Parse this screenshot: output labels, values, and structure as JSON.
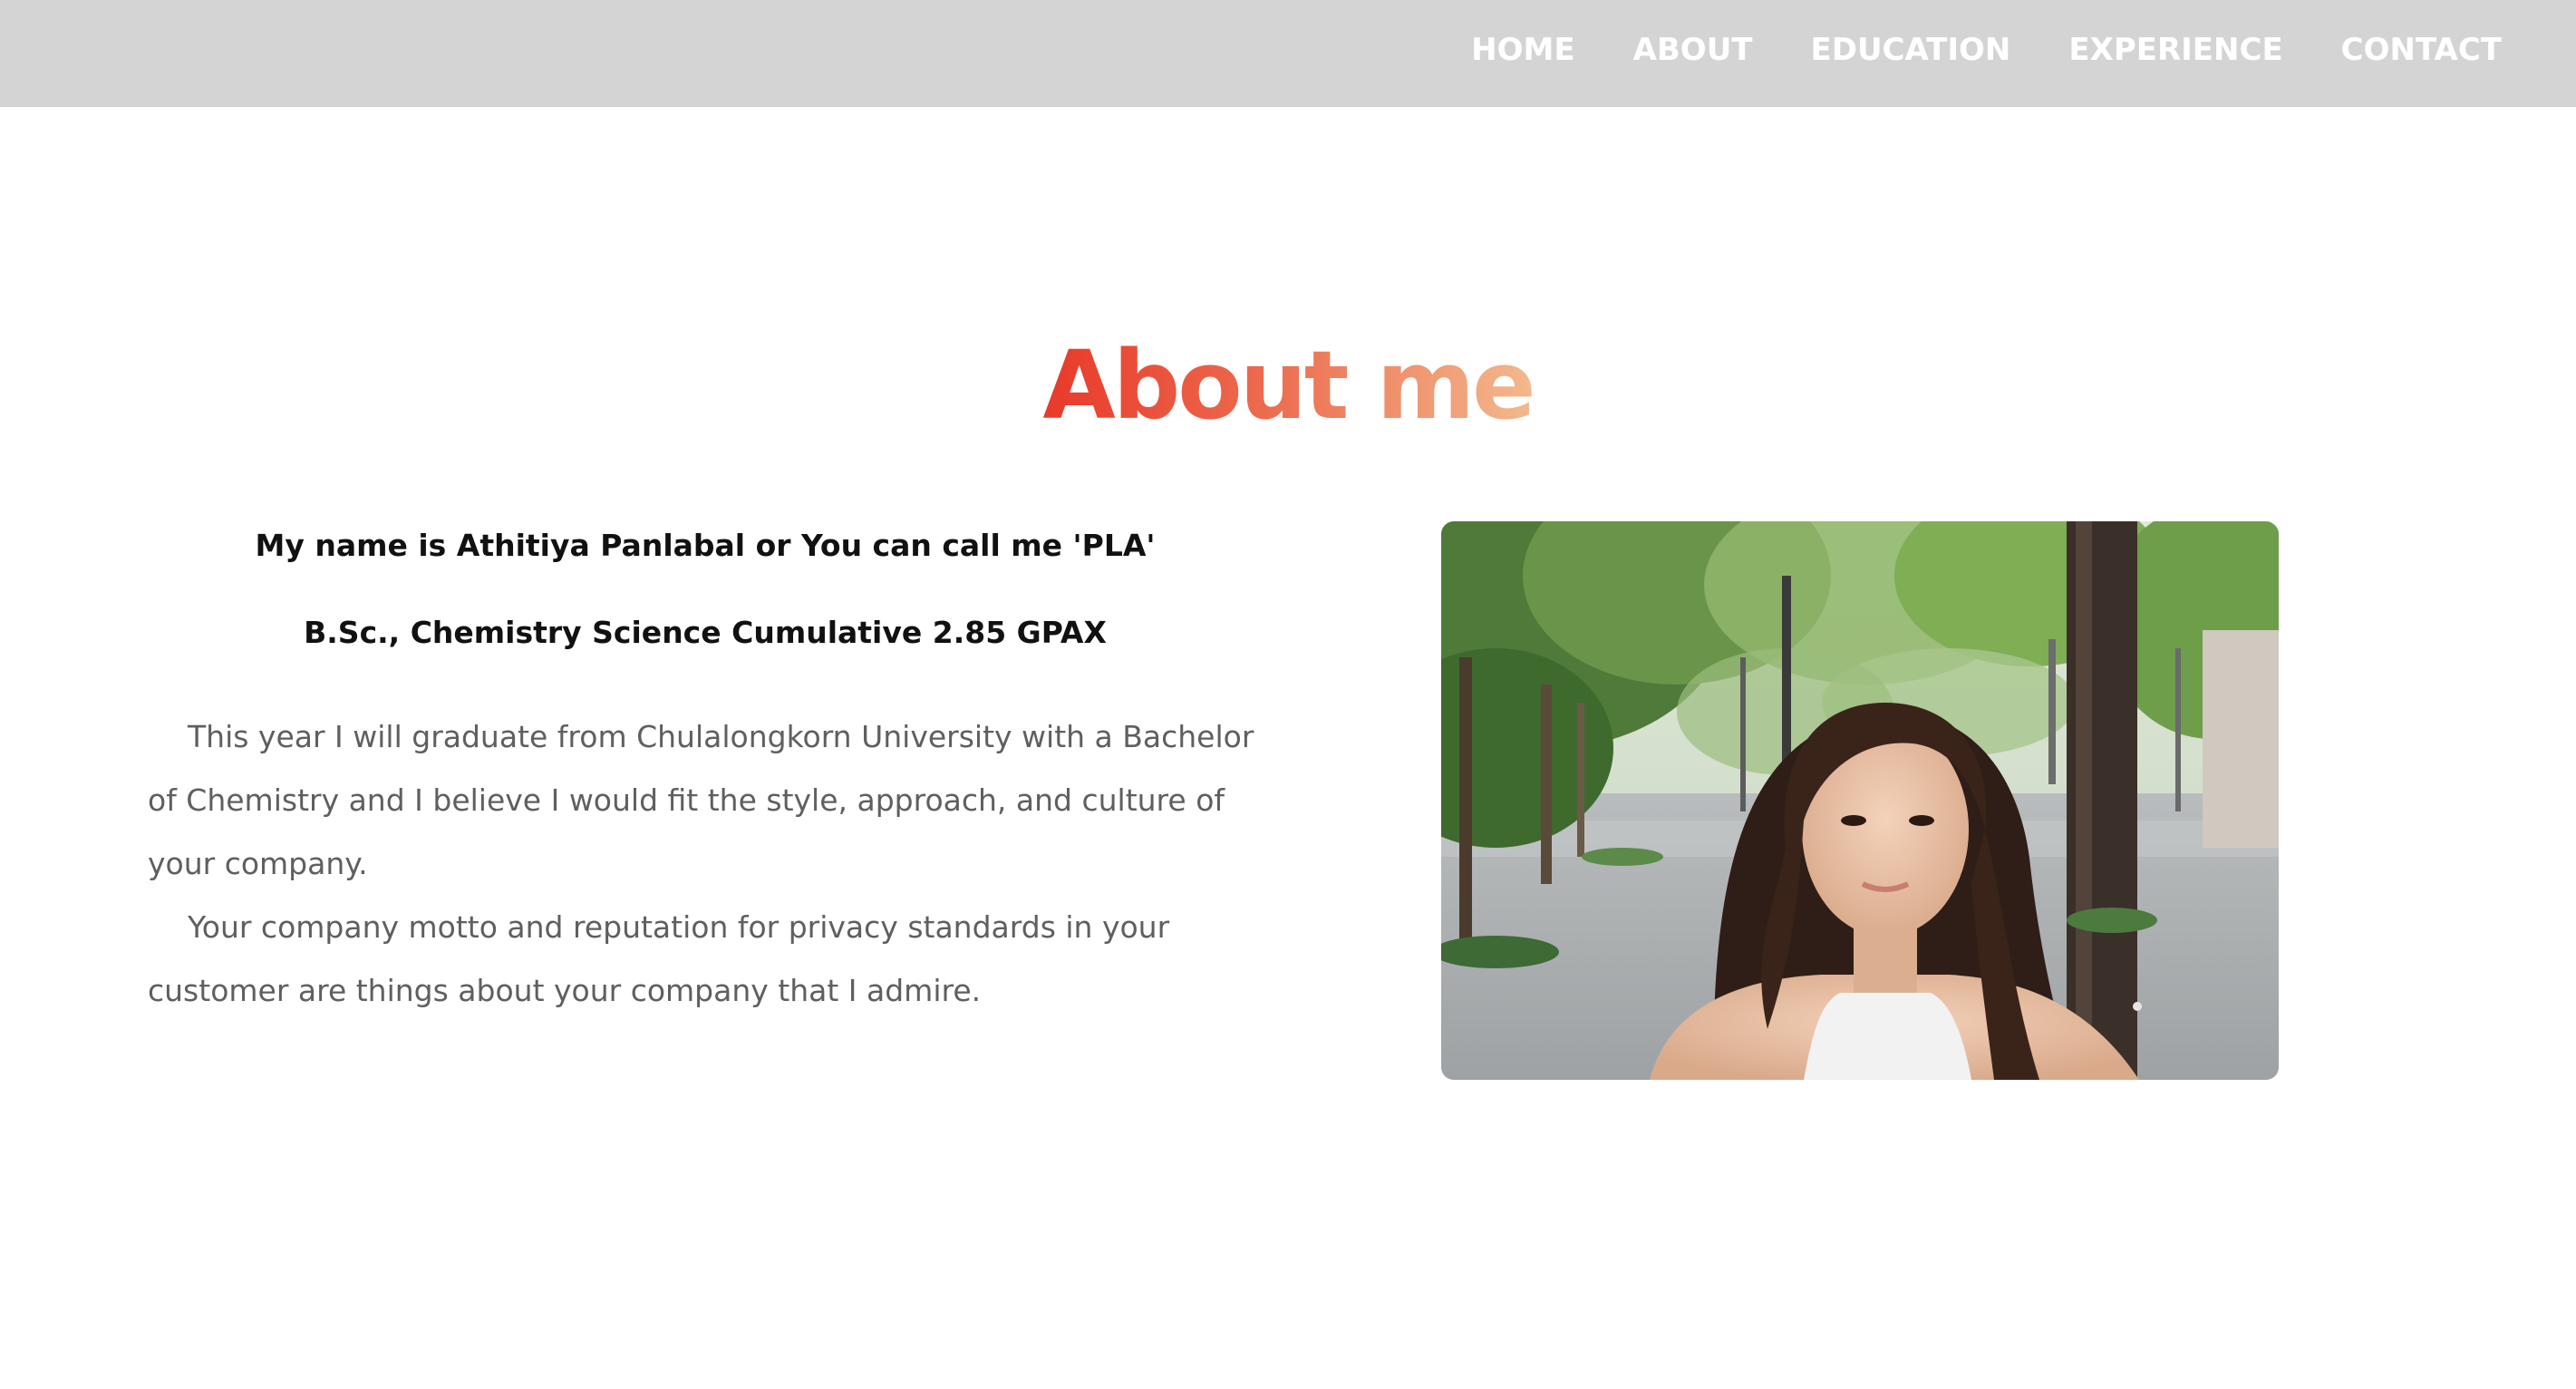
{
  "nav": {
    "items": [
      {
        "label": "HOME"
      },
      {
        "label": "ABOUT"
      },
      {
        "label": "EDUCATION"
      },
      {
        "label": "EXPERIENCE"
      },
      {
        "label": "CONTACT"
      }
    ]
  },
  "about": {
    "title": "About me",
    "name_line": "My name is Athitiya Panlabal or You can call me 'PLA'",
    "degree_line": "B.Sc., Chemistry Science Cumulative 2.85 GPAX",
    "paragraphs": [
      "This year I will graduate from Chulalongkorn University with a Bachelor of Chemistry and I believe I would fit the style, approach, and culture of your company.",
      "Your company motto and reputation for privacy standards in your customer are things about your company that I admire."
    ]
  },
  "colors": {
    "navbar_bg": "#d4d4d4",
    "title_gradient_start": "#e8392a",
    "title_gradient_end": "#f3b98d",
    "body_text": "#5f5f5f"
  }
}
